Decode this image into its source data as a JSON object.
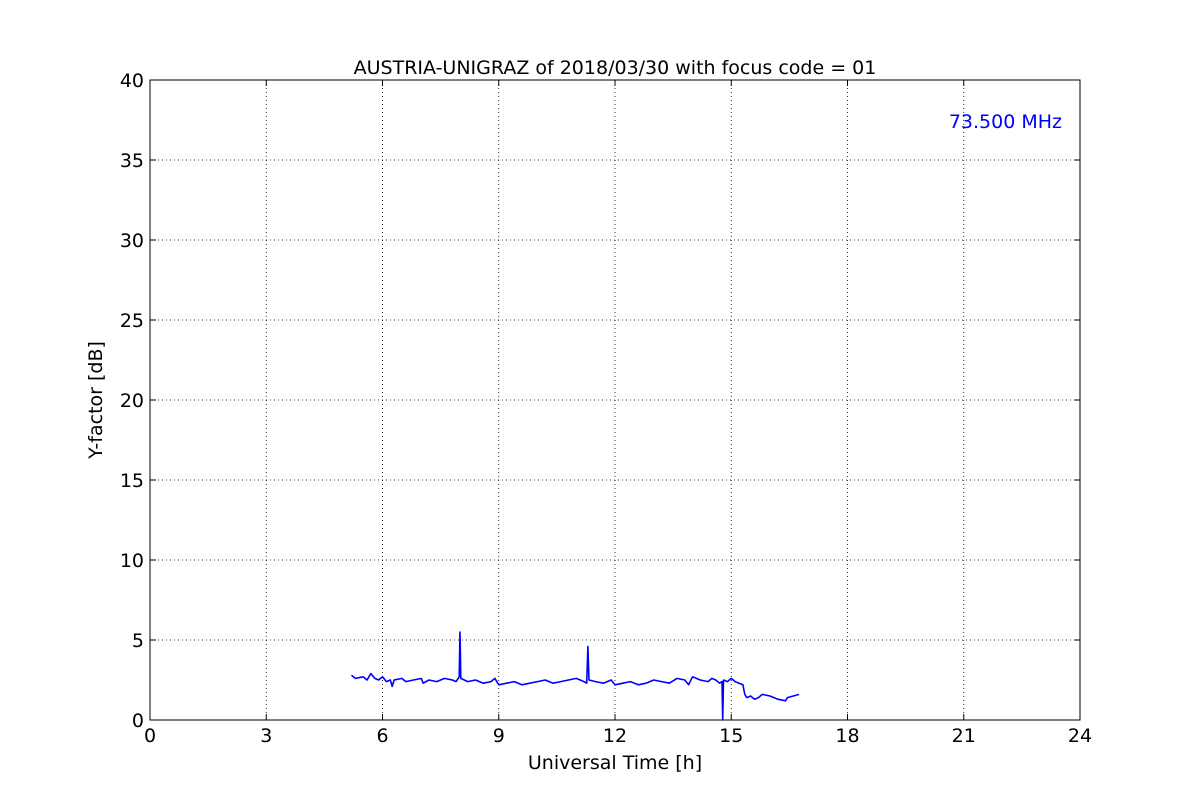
{
  "chart_data": {
    "type": "line",
    "title": "AUSTRIA-UNIGRAZ of 2018/03/30 with focus code = 01",
    "xlabel": "Universal Time [h]",
    "ylabel": "Y-factor [dB]",
    "xlim": [
      0,
      24
    ],
    "ylim": [
      0,
      40
    ],
    "xticks": [
      0,
      3,
      6,
      9,
      12,
      15,
      18,
      21,
      24
    ],
    "yticks": [
      0,
      5,
      10,
      15,
      20,
      25,
      30,
      35,
      40
    ],
    "grid": true,
    "annotation": {
      "text": "73.500 MHz",
      "color": "#0000ff",
      "placement": "top-right"
    },
    "series": [
      {
        "color": "#0000ff",
        "x": [
          5.2,
          5.3,
          5.5,
          5.6,
          5.7,
          5.8,
          5.9,
          6.0,
          6.1,
          6.2,
          6.25,
          6.3,
          6.5,
          6.6,
          6.8,
          7.0,
          7.05,
          7.2,
          7.4,
          7.6,
          7.8,
          7.9,
          7.98,
          8.0,
          8.02,
          8.2,
          8.4,
          8.6,
          8.8,
          8.9,
          9.0,
          9.2,
          9.4,
          9.6,
          9.8,
          10.0,
          10.2,
          10.4,
          10.6,
          10.8,
          11.0,
          11.2,
          11.27,
          11.3,
          11.33,
          11.5,
          11.7,
          11.9,
          12.0,
          12.2,
          12.4,
          12.6,
          12.8,
          13.0,
          13.2,
          13.4,
          13.6,
          13.8,
          13.9,
          14.0,
          14.2,
          14.4,
          14.5,
          14.6,
          14.7,
          14.76,
          14.78,
          14.8,
          14.9,
          15.0,
          15.1,
          15.2,
          15.3,
          15.35,
          15.4,
          15.5,
          15.6,
          15.7,
          15.8,
          16.0,
          16.1,
          16.2,
          16.4,
          16.45,
          16.6,
          16.75
        ],
        "y": [
          2.8,
          2.6,
          2.7,
          2.5,
          2.9,
          2.6,
          2.5,
          2.7,
          2.4,
          2.5,
          2.1,
          2.5,
          2.6,
          2.4,
          2.5,
          2.6,
          2.3,
          2.5,
          2.4,
          2.6,
          2.5,
          2.4,
          2.7,
          5.5,
          2.6,
          2.4,
          2.5,
          2.3,
          2.4,
          2.6,
          2.2,
          2.3,
          2.4,
          2.2,
          2.3,
          2.4,
          2.5,
          2.3,
          2.4,
          2.5,
          2.6,
          2.4,
          2.3,
          4.6,
          2.5,
          2.4,
          2.3,
          2.5,
          2.2,
          2.3,
          2.4,
          2.2,
          2.3,
          2.5,
          2.4,
          2.3,
          2.6,
          2.5,
          2.2,
          2.7,
          2.5,
          2.4,
          2.6,
          2.5,
          2.3,
          2.4,
          0.0,
          2.5,
          2.4,
          2.6,
          2.4,
          2.3,
          2.2,
          1.6,
          1.4,
          1.5,
          1.3,
          1.4,
          1.6,
          1.5,
          1.4,
          1.3,
          1.2,
          1.4,
          1.5,
          1.6
        ]
      }
    ]
  }
}
